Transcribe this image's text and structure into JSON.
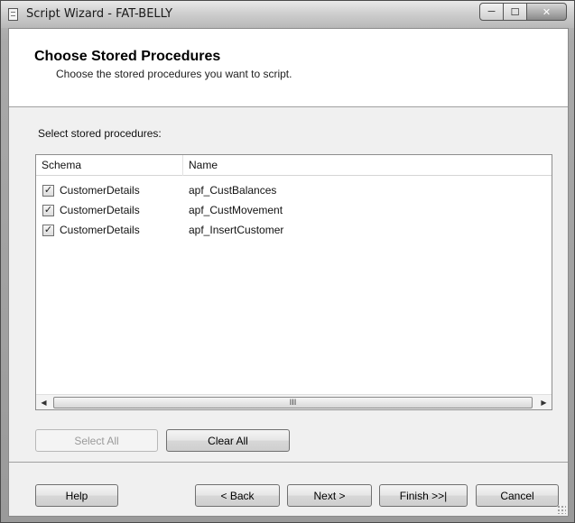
{
  "window": {
    "title": "Script Wizard - FAT-BELLY",
    "controls": {
      "minimize": "─",
      "maximize": "☐",
      "close": "✕"
    }
  },
  "header": {
    "title": "Choose Stored Procedures",
    "subtitle": "Choose the stored procedures you want to script."
  },
  "section_label": "Select stored procedures:",
  "list": {
    "columns": [
      "Schema",
      "Name"
    ],
    "rows": [
      {
        "checked": true,
        "check_glyph": "✓",
        "schema": "CustomerDetails",
        "name": "apf_CustBalances"
      },
      {
        "checked": true,
        "check_glyph": "✓",
        "schema": "CustomerDetails",
        "name": "apf_CustMovement"
      },
      {
        "checked": true,
        "check_glyph": "✓",
        "schema": "CustomerDetails",
        "name": "apf_InsertCustomer"
      }
    ],
    "scrollbar": {
      "left_arrow": "◀",
      "right_arrow": "▶",
      "thumb_grip": "III"
    }
  },
  "selection_buttons": {
    "select_all": "Select All",
    "clear_all": "Clear All"
  },
  "nav_buttons": {
    "help": "Help",
    "back": "< Back",
    "next": "Next >",
    "finish": "Finish >>|",
    "cancel": "Cancel"
  }
}
